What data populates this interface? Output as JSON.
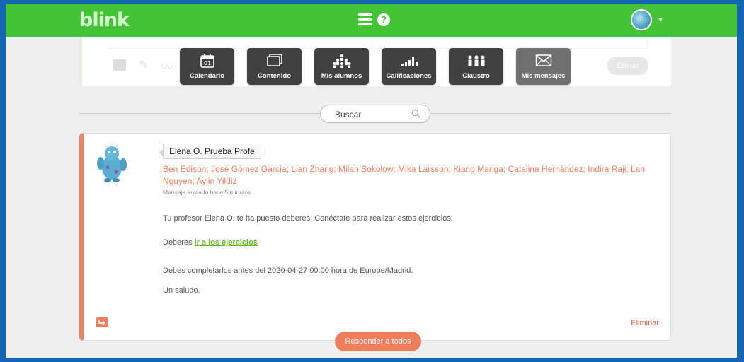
{
  "app": {
    "logo": "blink"
  },
  "header": {
    "help_label": "?"
  },
  "composer": {
    "send_label": "Enviar"
  },
  "launcher": [
    {
      "label": "Calendario",
      "icon": "calendar-icon",
      "date_badge": "01"
    },
    {
      "label": "Contenido",
      "icon": "content-icon"
    },
    {
      "label": "Mis alumnos",
      "icon": "students-icon"
    },
    {
      "label": "Calificaciones",
      "icon": "grades-icon"
    },
    {
      "label": "Claustro",
      "icon": "staff-icon"
    },
    {
      "label": "Mis mensajes",
      "icon": "envelope-icon",
      "active": true
    }
  ],
  "search": {
    "placeholder": "Buscar"
  },
  "message": {
    "sender": "Elena O. Prueba Profe",
    "recipients": "Ben Edison; José Gómez García; Lian Zhang; Milan Sokolow; Mika Larsson; Kiano Mariga; Catalina Hernández; Indira Raji; Lan Nguyen; Aylin Yildiz",
    "sent_time": "Mensaje enviado hace 5 minutos",
    "line1": "Tu profesor Elena O. te ha puesto deberes! Conéctate para realizar estos ejercicios:",
    "homework_prefix": "Deberes",
    "homework_link": "Ir a los ejercicios",
    "deadline": "Debes completarlos antes del 2020-04-27 00:00 hora de Europe/Madrid.",
    "closing": "Un saludo,",
    "delete_label": "Eliminar",
    "reply_all_label": "Responder a todos"
  },
  "colors": {
    "topbar": "#43c436",
    "accent": "#ee7d5e",
    "link": "#63b52b",
    "launcher_bg": "#404040",
    "frame_border": "#1565b5"
  }
}
